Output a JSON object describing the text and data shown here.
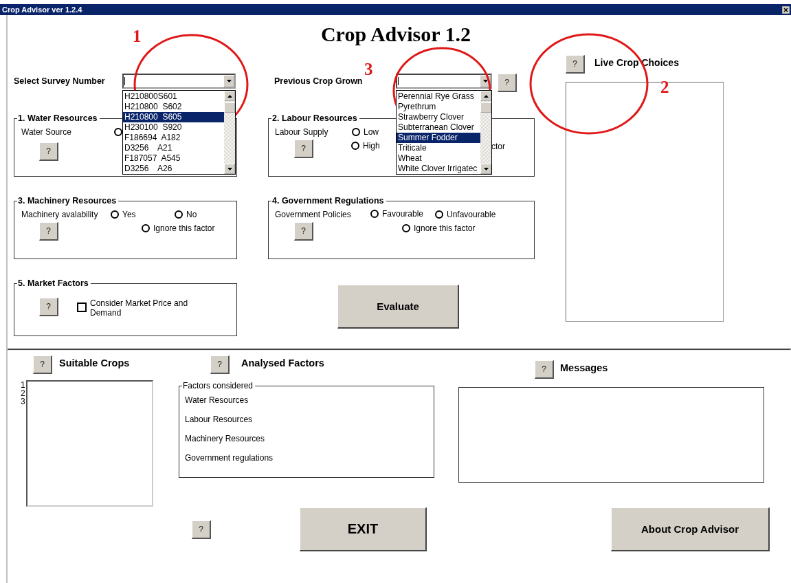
{
  "window": {
    "title": "Crop Advisor ver 1.2.4"
  },
  "heading": "Crop Advisor 1.2",
  "survey": {
    "label": "Select Survey Number",
    "options": [
      {
        "label": "H210800S601",
        "selected": false
      },
      {
        "label": "H210800  S602",
        "selected": false
      },
      {
        "label": "H210800  S605",
        "selected": true
      },
      {
        "label": "H230100  S920",
        "selected": false
      },
      {
        "label": "F186694  A182",
        "selected": false
      },
      {
        "label": "D3256    A21",
        "selected": false
      },
      {
        "label": "F187057  A545",
        "selected": false
      },
      {
        "label": "D3256    A26",
        "selected": false
      }
    ]
  },
  "previous_crop": {
    "label": "Previous Crop Grown",
    "help": "?",
    "options": [
      {
        "label": "Perennial Rye Grass",
        "selected": false
      },
      {
        "label": "Pyrethrum",
        "selected": false
      },
      {
        "label": "Strawberry Clover",
        "selected": false
      },
      {
        "label": "Subterranean Clover",
        "selected": false
      },
      {
        "label": "Summer Fodder",
        "selected": true
      },
      {
        "label": "Triticale",
        "selected": false
      },
      {
        "label": "Wheat",
        "selected": false
      },
      {
        "label": "White Clover Irrigatec",
        "selected": false
      }
    ]
  },
  "water": {
    "title": "1. Water Resources",
    "label": "Water Source",
    "help": "?",
    "options": [
      {
        "selected": false
      }
    ]
  },
  "labour": {
    "title": "2. Labour Resources",
    "label": "Labour Supply",
    "help": "?",
    "options": [
      {
        "label": "Low",
        "selected": false
      },
      {
        "label": "High",
        "selected": false
      }
    ],
    "partial_label": "ctor"
  },
  "machinery": {
    "title": "3. Machinery Resources",
    "label": "Machinery avalability",
    "help": "?",
    "options": [
      {
        "label": "Yes",
        "selected": false
      },
      {
        "label": "No",
        "selected": false
      },
      {
        "label": "Ignore this factor",
        "selected": false
      }
    ]
  },
  "government": {
    "title": "4. Government Regulations",
    "label": "Government Policies",
    "help": "?",
    "options": [
      {
        "label": "Favourable",
        "selected": false
      },
      {
        "label": "Unfavourable",
        "selected": false
      },
      {
        "label": "Ignore this factor",
        "selected": false
      }
    ]
  },
  "market": {
    "title": "5. Market Factors",
    "help": "?",
    "checkbox": {
      "label": "Consider Market Price and Demand",
      "checked": false
    }
  },
  "evaluate": "Evaluate",
  "live_crops": {
    "title": "Live Crop Choices",
    "help": "?"
  },
  "suitable_crops": {
    "title": "Suitable Crops",
    "help": "?",
    "ranks": [
      "1",
      "2",
      "3"
    ]
  },
  "analysed_factors": {
    "title": "Analysed Factors",
    "help": "?",
    "legend": "Factors considered",
    "items": [
      "Water Resources",
      "Labour Resources",
      "Machinery Resources",
      "Government regulations"
    ]
  },
  "messages": {
    "title": "Messages",
    "help": "?"
  },
  "footer": {
    "help": "?",
    "exit": "EXIT",
    "about": "About Crop Advisor"
  },
  "annotations": [
    {
      "label": "1"
    },
    {
      "label": "2"
    },
    {
      "label": "3"
    }
  ]
}
